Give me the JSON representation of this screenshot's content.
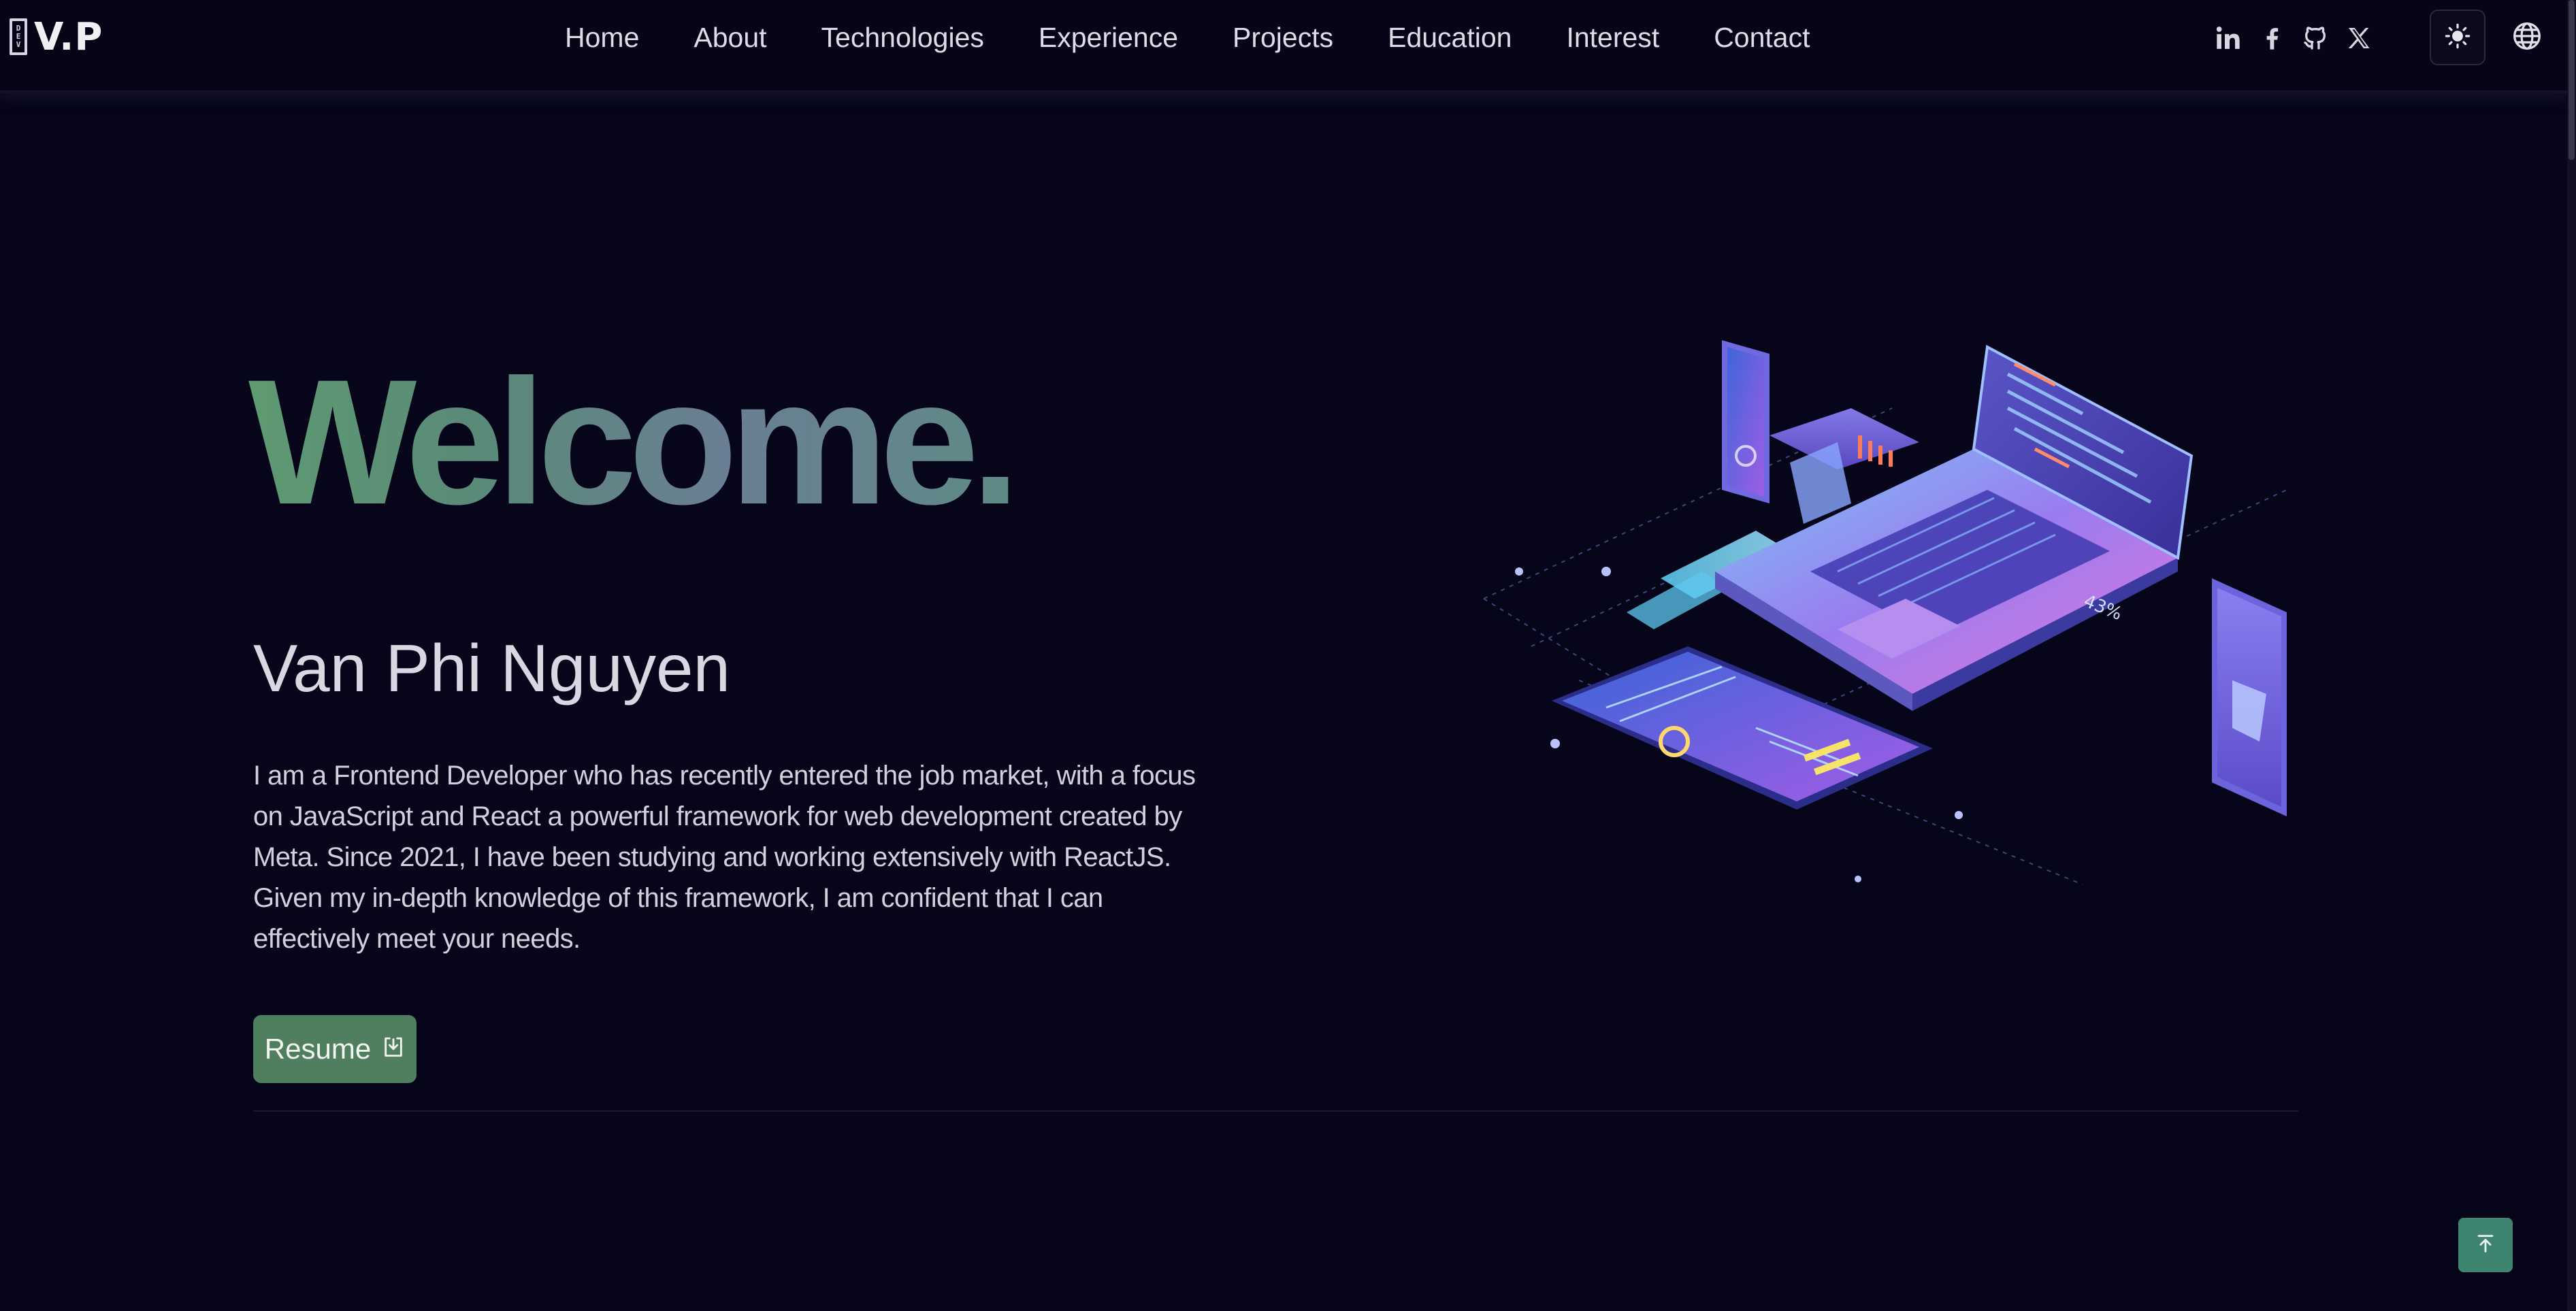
{
  "navbar": {
    "logo_badge": [
      "D",
      "E",
      "V"
    ],
    "logo_text": "V.P",
    "links": [
      {
        "label": "Home"
      },
      {
        "label": "About"
      },
      {
        "label": "Technologies"
      },
      {
        "label": "Experience"
      },
      {
        "label": "Projects"
      },
      {
        "label": "Education"
      },
      {
        "label": "Interest"
      },
      {
        "label": "Contact"
      }
    ],
    "socials": [
      {
        "icon": "linkedin-icon"
      },
      {
        "icon": "facebook-icon"
      },
      {
        "icon": "github-icon"
      },
      {
        "icon": "x-icon"
      }
    ],
    "theme_icon": "sun-icon",
    "language_icon": "globe-icon"
  },
  "hero": {
    "title": "Welcome.",
    "name": "Van Phi Nguyen",
    "description": "I am a Frontend Developer who has recently entered the job market, with a focus on JavaScript and React a powerful framework for web development created by Meta. Since 2021, I have been studying and working extensively with ReactJS. Given my in-depth knowledge of this framework, I am confident that I can effectively meet your needs.",
    "resume_label": "Resume",
    "resume_icon": "download-icon",
    "illustration_percent": "43%"
  },
  "back_to_top_icon": "arrow-up-to-line-icon",
  "colors": {
    "background": "#07051a",
    "accent": "#4f7f5f",
    "back_to_top": "#3f8470",
    "title_gradient": [
      "#5e9a72",
      "#6a7f93"
    ]
  }
}
